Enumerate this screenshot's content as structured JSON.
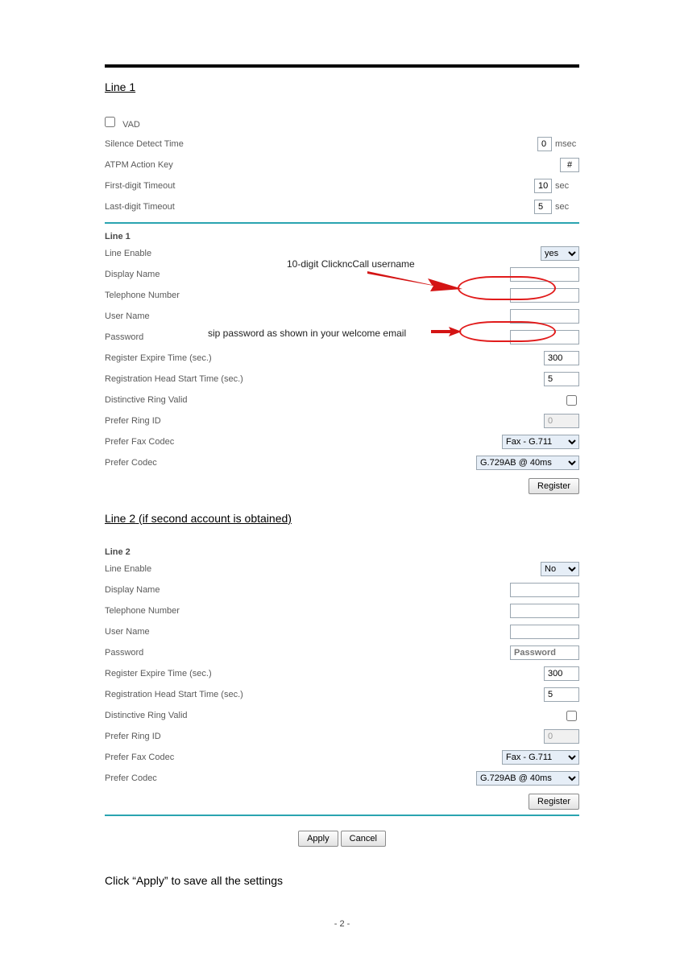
{
  "section1": {
    "heading": "Line 1",
    "vad_label": "VAD",
    "silence_detect_label": "Silence Detect Time",
    "silence_detect_value": "0",
    "silence_detect_unit": "msec",
    "atpm_label": "ATPM Action Key",
    "atpm_value": "#",
    "first_digit_label": "First-digit Timeout",
    "first_digit_value": "10",
    "first_digit_unit": "sec",
    "last_digit_label": "Last-digit Timeout",
    "last_digit_value": "5",
    "last_digit_unit": "sec",
    "sub_heading": "Line 1",
    "line_enable_label": "Line Enable",
    "line_enable_value": "yes",
    "display_name_label": "Display Name",
    "display_name_value": "",
    "telephone_label": "Telephone Number",
    "telephone_value": "",
    "username_label": "User Name",
    "username_value": "",
    "password_label": "Password",
    "password_value": "",
    "reg_expire_label": "Register Expire Time (sec.)",
    "reg_expire_value": "300",
    "reg_headstart_label": "Registration Head Start Time (sec.)",
    "reg_headstart_value": "5",
    "distinctive_label": "Distinctive Ring Valid",
    "prefer_ring_label": "Prefer Ring ID",
    "prefer_ring_value": "0",
    "prefer_fax_label": "Prefer Fax Codec",
    "prefer_fax_value": "Fax - G.711",
    "prefer_codec_label": "Prefer Codec",
    "prefer_codec_value": "G.729AB @ 40ms",
    "register_btn": "Register",
    "annotation_username": "10-digit ClickncCall username",
    "annotation_password": "sip password as shown in your welcome email"
  },
  "section2": {
    "heading": "Line 2",
    "heading_note": "(if second account is obtained)",
    "sub_heading": "Line 2",
    "line_enable_label": "Line Enable",
    "line_enable_value": "No",
    "display_name_label": "Display Name",
    "display_name_value": "",
    "telephone_label": "Telephone Number",
    "telephone_value": "",
    "username_label": "User Name",
    "username_value": "",
    "password_label": "Password",
    "password_placeholder": "Password",
    "password_value": "",
    "reg_expire_label": "Register Expire Time (sec.)",
    "reg_expire_value": "300",
    "reg_headstart_label": "Registration Head Start Time (sec.)",
    "reg_headstart_value": "5",
    "distinctive_label": "Distinctive Ring Valid",
    "prefer_ring_label": "Prefer Ring ID",
    "prefer_ring_value": "0",
    "prefer_fax_label": "Prefer Fax Codec",
    "prefer_fax_value": "Fax - G.711",
    "prefer_codec_label": "Prefer Codec",
    "prefer_codec_value": "G.729AB @ 40ms",
    "register_btn": "Register"
  },
  "buttons": {
    "apply": "Apply",
    "cancel": "Cancel"
  },
  "closing_text": "Click “Apply” to save all the settings",
  "page_number": "- 2 -"
}
